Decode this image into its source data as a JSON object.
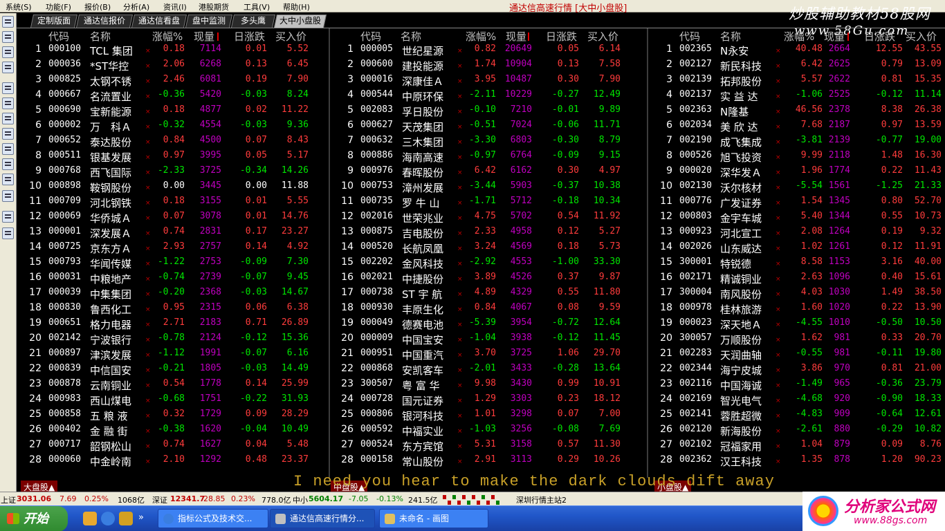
{
  "menu": [
    "系统(S)",
    "功能(F)",
    "报价(B)",
    "分析(A)",
    "资讯(I)",
    "港股期货",
    "工具(V)",
    "帮助(H)"
  ],
  "app_title": "通达信高速行情 [大中小盘股]",
  "watermark": {
    "line1": "炒股辅助教材58股网",
    "line2": "www.58Gu.com"
  },
  "tabs": [
    "定制版面",
    "通达信报价",
    "通达信看盘",
    "盘中监测",
    "多头鹰",
    "大中小盘股"
  ],
  "active_tab": 5,
  "headers": [
    "代码",
    "名称",
    "涨幅%",
    "现量",
    "日涨跌",
    "买入价"
  ],
  "panels": [
    {
      "rows": [
        [
          "1",
          "000100",
          "TCL 集团",
          "0.18",
          "7114",
          "0.01",
          "5.52"
        ],
        [
          "2",
          "000036",
          "*ST华控",
          "2.06",
          "6268",
          "0.13",
          "6.45"
        ],
        [
          "3",
          "000825",
          "太钢不锈",
          "2.46",
          "6081",
          "0.19",
          "7.90"
        ],
        [
          "4",
          "000667",
          "名流置业",
          "-0.36",
          "5420",
          "-0.03",
          "8.24"
        ],
        [
          "5",
          "000690",
          "宝新能源",
          "0.18",
          "4877",
          "0.02",
          "11.22"
        ],
        [
          "6",
          "000002",
          "万　科Ａ",
          "-0.32",
          "4554",
          "-0.03",
          "9.36"
        ],
        [
          "7",
          "000652",
          "泰达股份",
          "0.84",
          "4500",
          "0.07",
          "8.43"
        ],
        [
          "8",
          "000511",
          "银基发展",
          "0.97",
          "3995",
          "0.05",
          "5.17"
        ],
        [
          "9",
          "000768",
          "西飞国际",
          "-2.33",
          "3725",
          "-0.34",
          "14.26"
        ],
        [
          "10",
          "000898",
          "鞍钢股份",
          "0.00",
          "3445",
          "0.00",
          "11.88"
        ],
        [
          "11",
          "000709",
          "河北钢铁",
          "0.18",
          "3155",
          "0.01",
          "5.55"
        ],
        [
          "12",
          "000069",
          "华侨城Ａ",
          "0.07",
          "3078",
          "0.01",
          "14.76"
        ],
        [
          "13",
          "000001",
          "深发展Ａ",
          "0.74",
          "2831",
          "0.17",
          "23.27"
        ],
        [
          "14",
          "000725",
          "京东方Ａ",
          "2.93",
          "2757",
          "0.14",
          "4.92"
        ],
        [
          "15",
          "000793",
          "华闻传媒",
          "-1.22",
          "2753",
          "-0.09",
          "7.30"
        ],
        [
          "16",
          "000031",
          "中粮地产",
          "-0.74",
          "2739",
          "-0.07",
          "9.45"
        ],
        [
          "17",
          "000039",
          "中集集团",
          "-0.20",
          "2368",
          "-0.03",
          "14.67"
        ],
        [
          "18",
          "000830",
          "鲁西化工",
          "0.95",
          "2315",
          "0.06",
          "6.38"
        ],
        [
          "19",
          "000651",
          "格力电器",
          "2.71",
          "2183",
          "0.71",
          "26.89"
        ],
        [
          "20",
          "002142",
          "宁波银行",
          "-0.78",
          "2124",
          "-0.12",
          "15.36"
        ],
        [
          "21",
          "000897",
          "津滨发展",
          "-1.12",
          "1991",
          "-0.07",
          "6.16"
        ],
        [
          "22",
          "000839",
          "中信国安",
          "-0.21",
          "1805",
          "-0.03",
          "14.49"
        ],
        [
          "23",
          "000878",
          "云南铜业",
          "0.54",
          "1778",
          "0.14",
          "25.99"
        ],
        [
          "24",
          "000983",
          "西山煤电",
          "-0.68",
          "1751",
          "-0.22",
          "31.93"
        ],
        [
          "25",
          "000858",
          "五 粮 液",
          "0.32",
          "1729",
          "0.09",
          "28.29"
        ],
        [
          "26",
          "000402",
          "金 融 街",
          "-0.38",
          "1620",
          "-0.04",
          "10.49"
        ],
        [
          "27",
          "000717",
          "韶钢松山",
          "0.74",
          "1627",
          "0.04",
          "5.48"
        ],
        [
          "28",
          "000060",
          "中金岭南",
          "2.10",
          "1292",
          "0.48",
          "23.37"
        ]
      ]
    },
    {
      "rows": [
        [
          "1",
          "000005",
          "世纪星源",
          "0.82",
          "20649",
          "0.05",
          "6.14"
        ],
        [
          "2",
          "000600",
          "建投能源",
          "1.74",
          "10904",
          "0.13",
          "7.58"
        ],
        [
          "3",
          "000016",
          "深康佳Ａ",
          "3.95",
          "10487",
          "0.30",
          "7.90"
        ],
        [
          "4",
          "000544",
          "中原环保",
          "-2.11",
          "10229",
          "-0.27",
          "12.49"
        ],
        [
          "5",
          "002083",
          "孚日股份",
          "-0.10",
          "7210",
          "-0.01",
          "9.89"
        ],
        [
          "6",
          "000627",
          "天茂集团",
          "-0.51",
          "7024",
          "-0.06",
          "11.71"
        ],
        [
          "7",
          "000632",
          "三木集团",
          "-3.30",
          "6803",
          "-0.30",
          "8.79"
        ],
        [
          "8",
          "000886",
          "海南高速",
          "-0.97",
          "6764",
          "-0.09",
          "9.15"
        ],
        [
          "9",
          "000976",
          "春晖股份",
          "6.42",
          "6162",
          "0.30",
          "4.97"
        ],
        [
          "10",
          "000753",
          "漳州发展",
          "-3.44",
          "5903",
          "-0.37",
          "10.38"
        ],
        [
          "11",
          "000735",
          "罗 牛 山",
          "-1.71",
          "5712",
          "-0.18",
          "10.34"
        ],
        [
          "12",
          "002016",
          "世荣兆业",
          "4.75",
          "5702",
          "0.54",
          "11.92"
        ],
        [
          "13",
          "000875",
          "吉电股份",
          "2.33",
          "4958",
          "0.12",
          "5.27"
        ],
        [
          "14",
          "000520",
          "长航凤凰",
          "3.24",
          "4569",
          "0.18",
          "5.73"
        ],
        [
          "15",
          "002202",
          "金风科技",
          "-2.92",
          "4553",
          "-1.00",
          "33.30"
        ],
        [
          "16",
          "002021",
          "中捷股份",
          "3.89",
          "4526",
          "0.37",
          "9.87"
        ],
        [
          "17",
          "000738",
          "ST 宇 航",
          "4.89",
          "4329",
          "0.55",
          "11.80"
        ],
        [
          "18",
          "000930",
          "丰原生化",
          "0.84",
          "4067",
          "0.08",
          "9.59"
        ],
        [
          "19",
          "000049",
          "德赛电池",
          "-5.39",
          "3954",
          "-0.72",
          "12.64"
        ],
        [
          "20",
          "000009",
          "中国宝安",
          "-1.04",
          "3938",
          "-0.12",
          "11.45"
        ],
        [
          "21",
          "000951",
          "中国重汽",
          "3.70",
          "3725",
          "1.06",
          "29.70"
        ],
        [
          "22",
          "000868",
          "安凯客车",
          "-2.01",
          "3433",
          "-0.28",
          "13.64"
        ],
        [
          "23",
          "300507",
          "粤 富 华",
          "9.98",
          "3430",
          "0.99",
          "10.91"
        ],
        [
          "24",
          "000728",
          "国元证券",
          "1.29",
          "3303",
          "0.23",
          "18.12"
        ],
        [
          "25",
          "000806",
          "银河科技",
          "1.01",
          "3298",
          "0.07",
          "7.00"
        ],
        [
          "26",
          "000592",
          "中福实业",
          "-1.03",
          "3256",
          "-0.08",
          "7.69"
        ],
        [
          "27",
          "000524",
          "东方宾馆",
          "5.31",
          "3158",
          "0.57",
          "11.30"
        ],
        [
          "28",
          "000158",
          "常山股份",
          "2.91",
          "3113",
          "0.29",
          "10.26"
        ]
      ]
    },
    {
      "rows": [
        [
          "1",
          "002365",
          "N永安",
          "40.48",
          "2664",
          "12.55",
          "43.55"
        ],
        [
          "2",
          "002127",
          "新民科技",
          "6.42",
          "2625",
          "0.79",
          "13.09"
        ],
        [
          "3",
          "002139",
          "拓邦股份",
          "5.57",
          "2622",
          "0.81",
          "15.35"
        ],
        [
          "4",
          "002137",
          "实 益 达",
          "-1.06",
          "2525",
          "-0.12",
          "11.14"
        ],
        [
          "5",
          "002363",
          "N隆基",
          "46.56",
          "2378",
          "8.38",
          "26.38"
        ],
        [
          "6",
          "002034",
          "美 欣 达",
          "7.68",
          "2187",
          "0.97",
          "13.59"
        ],
        [
          "7",
          "002190",
          "成飞集成",
          "-3.81",
          "2139",
          "-0.77",
          "19.00"
        ],
        [
          "8",
          "000526",
          "旭飞投资",
          "9.99",
          "2118",
          "1.48",
          "16.30"
        ],
        [
          "9",
          "000020",
          "深华发Ａ",
          "1.96",
          "1774",
          "0.22",
          "11.43"
        ],
        [
          "10",
          "002130",
          "沃尔核材",
          "-5.54",
          "1561",
          "-1.25",
          "21.33"
        ],
        [
          "11",
          "000776",
          "广发证券",
          "1.54",
          "1345",
          "0.80",
          "52.70"
        ],
        [
          "12",
          "000803",
          "金宇车城",
          "5.40",
          "1344",
          "0.55",
          "10.73"
        ],
        [
          "13",
          "000923",
          "河北宣工",
          "2.08",
          "1264",
          "0.19",
          "9.32"
        ],
        [
          "14",
          "002026",
          "山东威达",
          "1.02",
          "1261",
          "0.12",
          "11.91"
        ],
        [
          "15",
          "300001",
          "特锐德",
          "8.58",
          "1153",
          "3.16",
          "40.00"
        ],
        [
          "16",
          "002171",
          "精诚铜业",
          "2.63",
          "1096",
          "0.40",
          "15.61"
        ],
        [
          "17",
          "300004",
          "南风股份",
          "4.03",
          "1030",
          "1.49",
          "38.50"
        ],
        [
          "18",
          "000978",
          "桂林旅游",
          "1.60",
          "1020",
          "0.22",
          "13.90"
        ],
        [
          "19",
          "000023",
          "深天地Ａ",
          "-4.55",
          "1010",
          "-0.50",
          "10.50"
        ],
        [
          "20",
          "300057",
          "万顺股份",
          "1.62",
          "981",
          "0.33",
          "20.70"
        ],
        [
          "21",
          "002283",
          "天润曲轴",
          "-0.55",
          "981",
          "-0.11",
          "19.80"
        ],
        [
          "22",
          "002344",
          "海宁皮城",
          "3.86",
          "970",
          "0.81",
          "21.00"
        ],
        [
          "23",
          "002116",
          "中国海诚",
          "-1.49",
          "965",
          "-0.36",
          "23.79"
        ],
        [
          "24",
          "002169",
          "智光电气",
          "-4.68",
          "920",
          "-0.90",
          "18.33"
        ],
        [
          "25",
          "002141",
          "蓉胜超微",
          "-4.83",
          "909",
          "-0.64",
          "12.61"
        ],
        [
          "26",
          "002120",
          "新海股份",
          "-2.61",
          "880",
          "-0.29",
          "10.82"
        ],
        [
          "27",
          "002102",
          "冠福家用",
          "1.04",
          "879",
          "0.09",
          "8.76"
        ],
        [
          "28",
          "002362",
          "汉王科技",
          "1.35",
          "878",
          "1.20",
          "90.23"
        ]
      ]
    }
  ],
  "bottom_tabs": [
    "大盘股▲",
    "中盘股▲",
    "小盘股▲"
  ],
  "lyric": "I need you hear to make the dark clouds dift away",
  "status": {
    "sh_label": "上证",
    "sh_index": "3031.06",
    "sh_change": "7.69",
    "sh_pct": "0.25%",
    "sh_amount": "1068亿",
    "sz_label": "深证",
    "sz_index": "12341.7",
    "sz_change": "28.85",
    "sz_pct": "0.23%",
    "sz_amount": "778.0亿",
    "zx_label": "中小",
    "zx_index": "5604.17",
    "zx_change": "-7.05",
    "zx_pct": "-0.13%",
    "zx_amount": "241.5亿",
    "server": "深圳行情主站2"
  },
  "taskbar": {
    "start_label": "开始",
    "tasks": [
      "指标公式及技术交...",
      "通达信高速行情分...",
      "未命名 - 画图"
    ]
  },
  "logo": {
    "name": "分析家公式网",
    "url": "www.88gs.com"
  },
  "colors": {
    "up": "#ff3c3c",
    "down": "#00e600",
    "volume": "#c000c0",
    "background": "#000000"
  }
}
